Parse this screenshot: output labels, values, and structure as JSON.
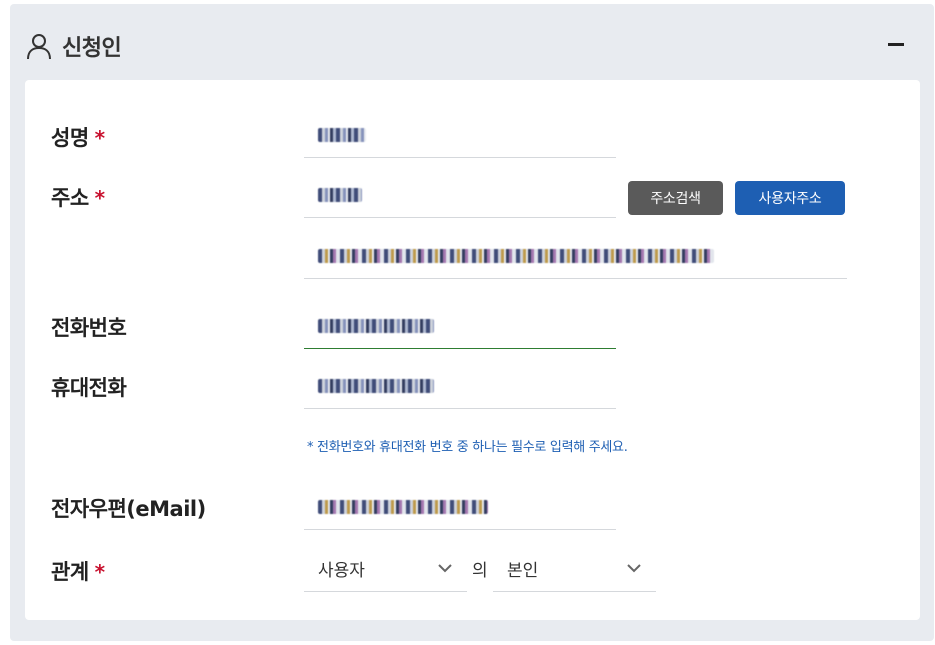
{
  "header": {
    "title": "신청인",
    "icon": "user-icon",
    "collapse_icon": "minus-icon"
  },
  "form": {
    "name": {
      "label": "성명",
      "required_mark": "*"
    },
    "address": {
      "label": "주소",
      "required_mark": "*",
      "search_button": "주소검색",
      "user_address_button": "사용자주소"
    },
    "phone": {
      "label": "전화번호"
    },
    "mobile": {
      "label": "휴대전화"
    },
    "phone_note": "*  전화번호와 휴대전화 번호 중 하나는 필수로 입력해 주세요.",
    "email": {
      "label": "전자우편(eMail)"
    },
    "relation": {
      "label": "관계",
      "required_mark": "*",
      "subject_value": "사용자",
      "connector": "의",
      "object_value": "본인"
    }
  },
  "colors": {
    "panel_bg": "#e8ebf0",
    "required": "#c8102e",
    "accent_blue": "#1e5fb3",
    "button_dark": "#5a5a5a",
    "focus_underline": "#2e7d32"
  }
}
